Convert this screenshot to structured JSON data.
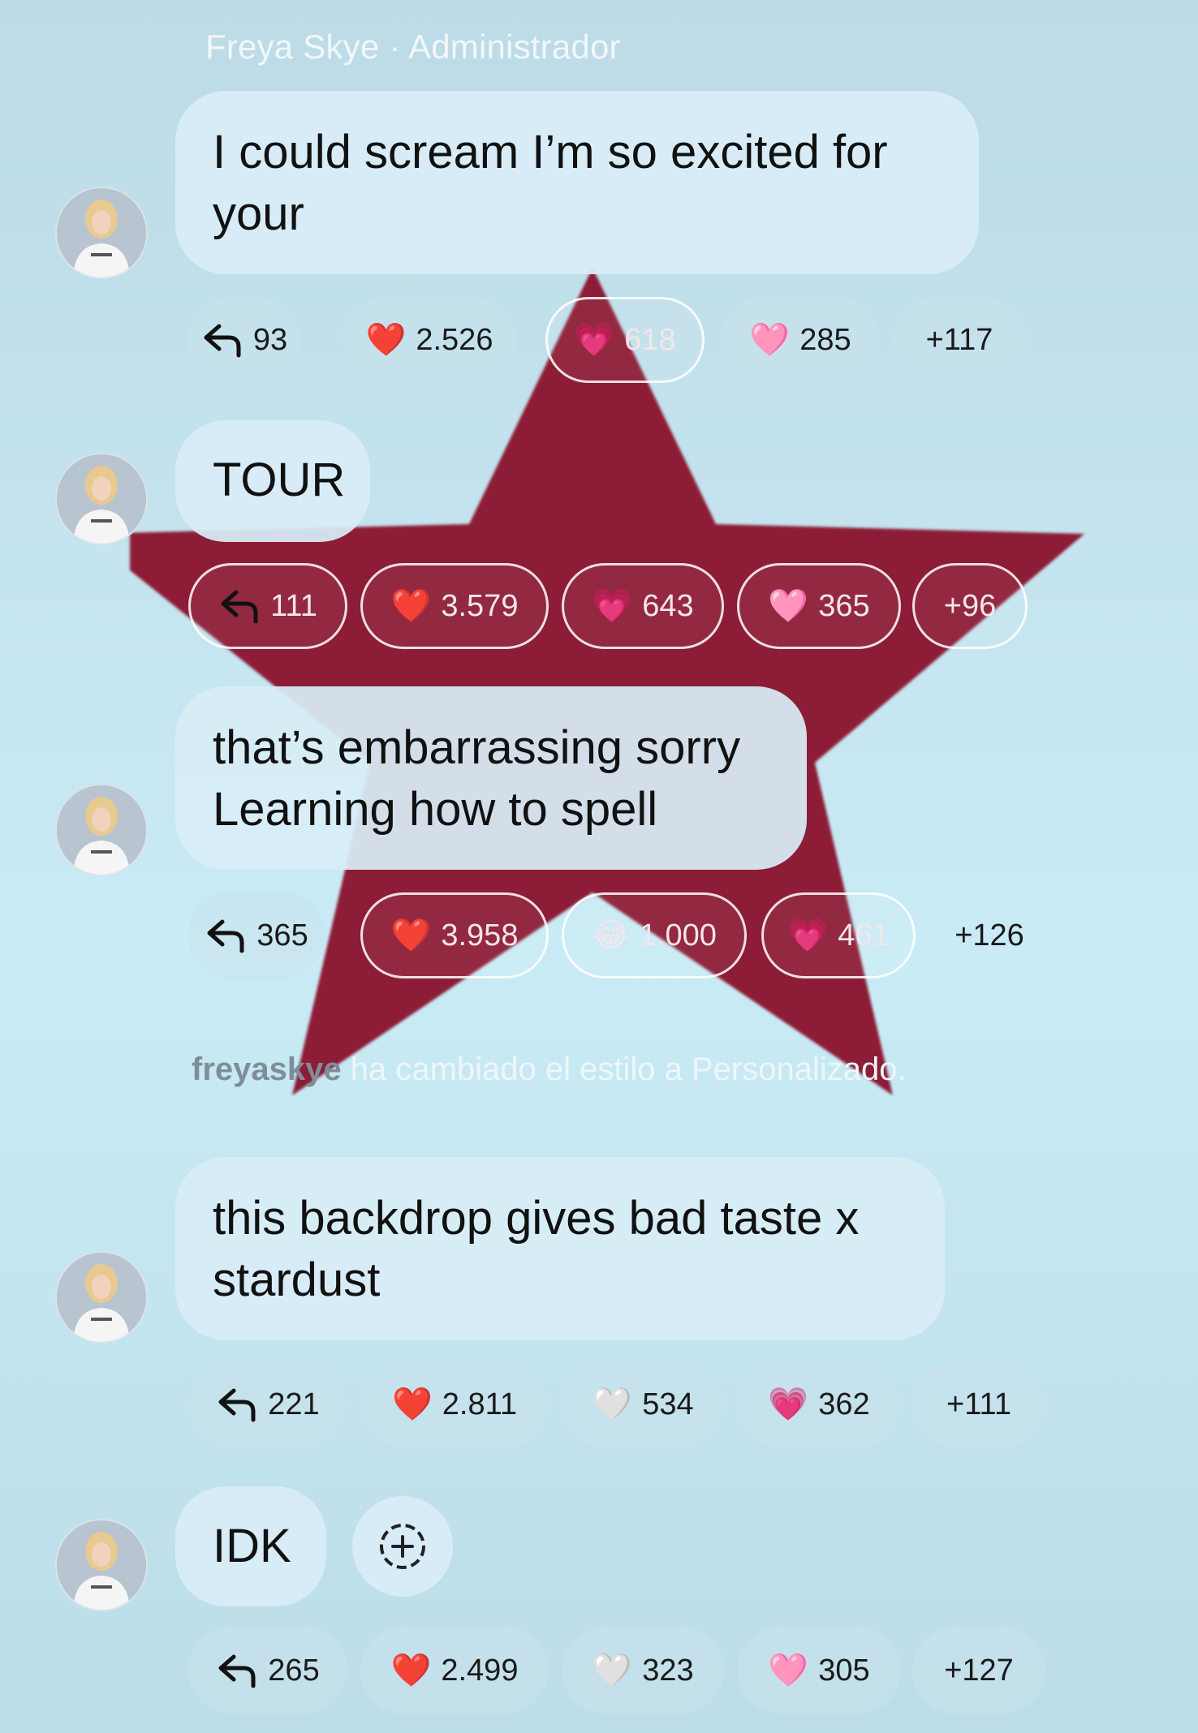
{
  "header": {
    "sender": "Freya Skye",
    "separator": " · ",
    "role": "Administrador"
  },
  "messages": [
    {
      "lines": [
        "I could scream I’m so excited for",
        "your"
      ],
      "reactions": {
        "replies": "93",
        "items": [
          {
            "emoji": "❤️",
            "count": "2.526"
          },
          {
            "emoji": "💗",
            "count": "618"
          },
          {
            "emoji": "🩷",
            "count": "285"
          }
        ],
        "more": "+117"
      }
    },
    {
      "lines": [
        "TOUR"
      ],
      "reactions": {
        "replies": "111",
        "items": [
          {
            "emoji": "❤️",
            "count": "3.579"
          },
          {
            "emoji": "💗",
            "count": "643"
          },
          {
            "emoji": "🩷",
            "count": "365"
          }
        ],
        "more": "+96"
      }
    },
    {
      "lines": [
        "that’s embarrassing sorry",
        "Learning how to spell"
      ],
      "reactions": {
        "replies": "365",
        "items": [
          {
            "emoji": "❤️",
            "count": "3.958"
          },
          {
            "emoji": "😂",
            "count": "1.000"
          },
          {
            "emoji": "💗",
            "count": "461"
          }
        ],
        "more": "+126"
      }
    },
    {
      "lines": [
        "this backdrop gives bad taste x",
        "stardust"
      ],
      "reactions": {
        "replies": "221",
        "items": [
          {
            "emoji": "❤️",
            "count": "2.811"
          },
          {
            "emoji": "🤍",
            "count": "534"
          },
          {
            "emoji": "💗",
            "count": "362"
          }
        ],
        "more": "+111"
      }
    },
    {
      "lines": [
        "IDK"
      ],
      "reactions": {
        "replies": "265",
        "items": [
          {
            "emoji": "❤️",
            "count": "2.499"
          },
          {
            "emoji": "🤍",
            "count": "323"
          },
          {
            "emoji": "🩷",
            "count": "305"
          }
        ],
        "more": "+127"
      }
    }
  ],
  "system_message": {
    "user": "freyaskye",
    "text": " ha cambiado el estilo a Personalizado."
  },
  "colors": {
    "star": "#8d1c36",
    "bubble": "#d8edf6",
    "background": "#c6e6f1"
  },
  "icons": {
    "reply": "reply-arrow-icon",
    "add_reaction": "add-reaction-icon"
  }
}
